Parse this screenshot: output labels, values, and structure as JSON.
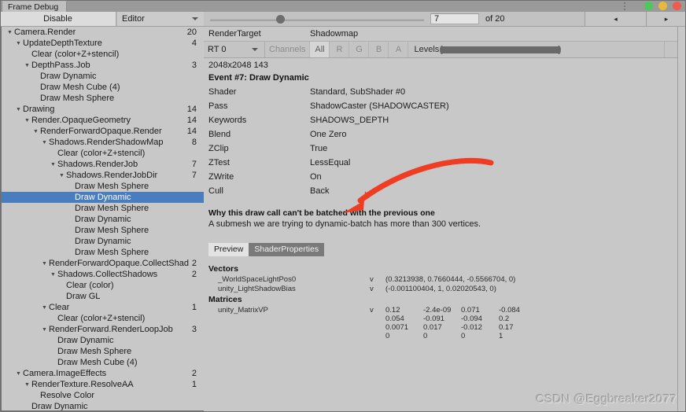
{
  "window": {
    "tab_title": "Frame Debug",
    "lights": [
      "#4dc95a",
      "#e8b93a",
      "#ef5b4f"
    ]
  },
  "left_toolbar": {
    "disable_label": "Disable",
    "target_label": "Editor"
  },
  "event_nav": {
    "current": "7",
    "of_label": "of 20",
    "total": 20,
    "prev_icon": "triangle-left-icon",
    "next_icon": "triangle-right-icon"
  },
  "render_target": {
    "label": "RenderTarget",
    "value": "Shadowmap",
    "rt_select": "RT 0",
    "channels_label": "Channels",
    "channels": [
      "All",
      "R",
      "G",
      "B",
      "A"
    ],
    "channel_active": "All",
    "levels_label": "Levels",
    "dimensions": "2048x2048 143"
  },
  "event": {
    "title": "Event #7: Draw Dynamic",
    "properties": [
      {
        "key": "Shader",
        "value": "Standard, SubShader #0"
      },
      {
        "key": "Pass",
        "value": "ShadowCaster (SHADOWCASTER)"
      },
      {
        "key": "Keywords",
        "value": "SHADOWS_DEPTH"
      },
      {
        "key": "Blend",
        "value": "One Zero"
      },
      {
        "key": "ZClip",
        "value": "True"
      },
      {
        "key": "ZTest",
        "value": "LessEqual"
      },
      {
        "key": "ZWrite",
        "value": "On"
      },
      {
        "key": "Cull",
        "value": "Back"
      }
    ]
  },
  "batch_warning": {
    "heading": "Why this draw call can't be batched with the previous one",
    "body": "A submesh we are trying to dynamic-batch has more than 300 vertices."
  },
  "tabs": [
    {
      "label": "Preview",
      "active": false
    },
    {
      "label": "ShaderProperties",
      "active": true
    }
  ],
  "shader_properties": {
    "vectors_heading": "Vectors",
    "vectors": [
      {
        "name": "_WorldSpaceLightPos0",
        "type": "v",
        "value": "(0.3213938, 0.7660444, -0.5566704, 0)"
      },
      {
        "name": "unity_LightShadowBias",
        "type": "v",
        "value": "(-0.001100404, 1, 0.02020543, 0)"
      }
    ],
    "matrices_heading": "Matrices",
    "matrices": [
      {
        "name": "unity_MatrixVP",
        "type": "v",
        "rows": [
          [
            "0.12",
            "-2.4e-09",
            "0.071",
            "-0.084"
          ],
          [
            "0.054",
            "-0.091",
            "-0.094",
            "0.2"
          ],
          [
            "0.0071",
            "0.017",
            "-0.012",
            "0.17"
          ],
          [
            "0",
            "0",
            "0",
            "1"
          ]
        ]
      }
    ]
  },
  "tree": {
    "selected_index": 15,
    "rows": [
      {
        "depth": 0,
        "expander": "▼",
        "label": "Camera.Render",
        "count": "20"
      },
      {
        "depth": 1,
        "expander": "▼",
        "label": "UpdateDepthTexture",
        "count": "4"
      },
      {
        "depth": 2,
        "expander": "",
        "label": "Clear (color+Z+stencil)",
        "count": ""
      },
      {
        "depth": 2,
        "expander": "▼",
        "label": "DepthPass.Job",
        "count": "3"
      },
      {
        "depth": 3,
        "expander": "",
        "label": "Draw Dynamic",
        "count": ""
      },
      {
        "depth": 3,
        "expander": "",
        "label": "Draw Mesh Cube (4)",
        "count": ""
      },
      {
        "depth": 3,
        "expander": "",
        "label": "Draw Mesh Sphere",
        "count": ""
      },
      {
        "depth": 1,
        "expander": "▼",
        "label": "Drawing",
        "count": "14"
      },
      {
        "depth": 2,
        "expander": "▼",
        "label": "Render.OpaqueGeometry",
        "count": "14"
      },
      {
        "depth": 3,
        "expander": "▼",
        "label": "RenderForwardOpaque.Render",
        "count": "14"
      },
      {
        "depth": 4,
        "expander": "▼",
        "label": "Shadows.RenderShadowMap",
        "count": "8"
      },
      {
        "depth": 5,
        "expander": "",
        "label": "Clear (color+Z+stencil)",
        "count": ""
      },
      {
        "depth": 5,
        "expander": "▼",
        "label": "Shadows.RenderJob",
        "count": "7"
      },
      {
        "depth": 6,
        "expander": "▼",
        "label": "Shadows.RenderJobDir",
        "count": "7"
      },
      {
        "depth": 7,
        "expander": "",
        "label": "Draw Mesh Sphere",
        "count": ""
      },
      {
        "depth": 7,
        "expander": "",
        "label": "Draw Dynamic",
        "count": ""
      },
      {
        "depth": 7,
        "expander": "",
        "label": "Draw Mesh Sphere",
        "count": ""
      },
      {
        "depth": 7,
        "expander": "",
        "label": "Draw Dynamic",
        "count": ""
      },
      {
        "depth": 7,
        "expander": "",
        "label": "Draw Mesh Sphere",
        "count": ""
      },
      {
        "depth": 7,
        "expander": "",
        "label": "Draw Dynamic",
        "count": ""
      },
      {
        "depth": 7,
        "expander": "",
        "label": "Draw Mesh Sphere",
        "count": ""
      },
      {
        "depth": 4,
        "expander": "▼",
        "label": "RenderForwardOpaque.CollectShad",
        "count": "2"
      },
      {
        "depth": 5,
        "expander": "▼",
        "label": "Shadows.CollectShadows",
        "count": "2"
      },
      {
        "depth": 6,
        "expander": "",
        "label": "Clear (color)",
        "count": ""
      },
      {
        "depth": 6,
        "expander": "",
        "label": "Draw GL",
        "count": ""
      },
      {
        "depth": 4,
        "expander": "▼",
        "label": "Clear",
        "count": "1"
      },
      {
        "depth": 5,
        "expander": "",
        "label": "Clear (color+Z+stencil)",
        "count": ""
      },
      {
        "depth": 4,
        "expander": "▼",
        "label": "RenderForward.RenderLoopJob",
        "count": "3"
      },
      {
        "depth": 5,
        "expander": "",
        "label": "Draw Dynamic",
        "count": ""
      },
      {
        "depth": 5,
        "expander": "",
        "label": "Draw Mesh Sphere",
        "count": ""
      },
      {
        "depth": 5,
        "expander": "",
        "label": "Draw Mesh Cube (4)",
        "count": ""
      },
      {
        "depth": 1,
        "expander": "▼",
        "label": "Camera.ImageEffects",
        "count": "2"
      },
      {
        "depth": 2,
        "expander": "▼",
        "label": "RenderTexture.ResolveAA",
        "count": "1"
      },
      {
        "depth": 3,
        "expander": "",
        "label": "Resolve Color",
        "count": ""
      },
      {
        "depth": 2,
        "expander": "",
        "label": "Draw Dynamic",
        "count": ""
      }
    ]
  },
  "annotation": {
    "arrow_color": "#ee3d23"
  },
  "watermark": {
    "text": "CSDN @Eggbreaker2077"
  }
}
